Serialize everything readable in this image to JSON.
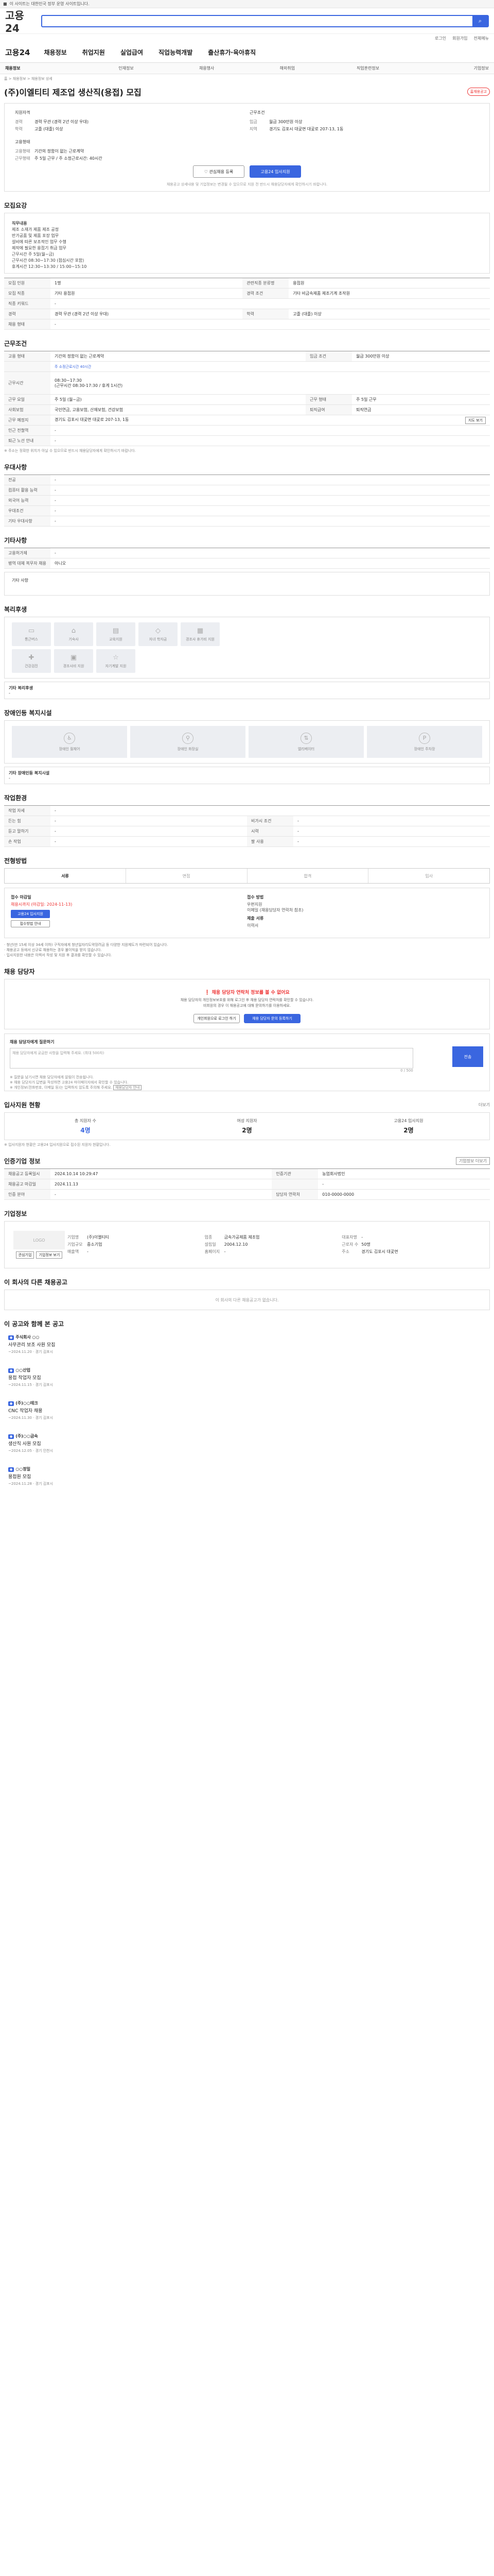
{
  "topbar": {
    "title": "고용24",
    "label": "이 사이트는 대한민국 정부 운영 사이트입니다."
  },
  "header": {
    "logo": "고용24",
    "search_icon": "search-icon"
  },
  "util": {
    "links": [
      "로그인",
      "회원가입",
      "전체메뉴"
    ]
  },
  "gnb": {
    "home": "고용24",
    "items": [
      "채용정보",
      "취업지원",
      "실업급여",
      "직업능력개발",
      "출산휴가·육아휴직"
    ]
  },
  "lnb": {
    "items": [
      "채용정보",
      "인재정보",
      "채용행사",
      "해외취업",
      "직업훈련정보",
      "기업정보"
    ]
  },
  "breadcrumb": "홈 > 채용정보 > 채용정보 상세",
  "job": {
    "badge": "홈채용공고",
    "title": "(주)이엘티티 제조업 생산직(용접) 모집",
    "summary": {
      "left_title": "지원자격",
      "career_k": "경력",
      "career_v": "경력 무관 (경력 2년 이상 우대)",
      "edu_k": "학력",
      "edu_v": "고졸 (대졸) 이상",
      "cond_title": "고용형태",
      "emp_k": "고용형태",
      "emp_v": "기간의 정함이 없는 근로계약",
      "hour_k": "근무형태",
      "hour_v": "주 5일 근무 / 주 소정근로시간: 40시간",
      "right_title": "근무조건",
      "wage_k": "임금",
      "wage_v": "월급 300만원 이상",
      "loc_k": "지역",
      "loc_v": "경기도 김포시 대곶면 대곶로 207-13, 1동"
    },
    "btn_interest": "관심채용 등록",
    "btn_apply": "고용24 입사지원",
    "notice": "채용공고 상세내용 및 기업정보는 변경될 수 있으므로 지원 전 반드시 채용담당자에게 확인하시기 바랍니다."
  },
  "recruit_section": {
    "title": "모집요강",
    "content_title": "직무내용",
    "content": "제조 소재가 제품 제조 공정\n반가공품 및 제품 포장 업무\n설비에 따른 보조적인 업무 수행\n제작에 필요한 용접기 취급 업무\n근무시간 주 5일(월~금)\n근무시간 08:30~17:30 (점심시간 포함)\n휴게시간 12:30~13:30 / 15:00~15:10",
    "rows": [
      [
        "모집 인원",
        "1명",
        "관련직종 분류명",
        "용접원"
      ],
      [
        "모집 직종",
        "기타 용접원",
        "경력 조건",
        "기타 비금속제품 제조기계 조작원"
      ],
      [
        "직종 키워드",
        "-",
        "",
        ""
      ],
      [
        "경력",
        "경력 무관 (경력 2년 이상 우대)",
        "학력",
        "고졸 (대졸) 이상"
      ],
      [
        "채용 형태",
        "-",
        "",
        ""
      ]
    ]
  },
  "work_section": {
    "title": "근무조건",
    "rows": [
      [
        "고용 형태",
        "기간의 정함이 없는 근로계약",
        "임금 조건",
        "월급 300만원 이상"
      ],
      [
        "",
        "주 소정근로시간 40시간",
        "",
        ""
      ],
      [
        "근무시간",
        "08:30~17:30\n(근무시간 08:30-17:30 / 휴게 1시간)",
        "",
        ""
      ],
      [
        "근무 요일",
        "주 5일 (월~금)",
        "근무 형태",
        "주 5일 근무"
      ],
      [
        "사회보험",
        "국민연금, 고용보험, 산재보험, 건강보험",
        "퇴직급여",
        "퇴직연금"
      ],
      [
        "근무 예정지",
        "경기도 김포시 대곶면 대곶로 207-13, 1동",
        "",
        ""
      ],
      [
        "인근 전철역",
        "-",
        "",
        ""
      ],
      [
        "퇴근 노선 안내",
        "-",
        "",
        ""
      ]
    ],
    "map_button": "지도 보기",
    "notice": "※ 주소는 정확한 위치가 아닐 수 있으므로 반드시 채용담당자에게 확인하시기 바랍니다."
  },
  "benefit_section": {
    "title": "우대사항",
    "rows": [
      [
        "전공",
        "-"
      ],
      [
        "컴퓨터 활용 능력",
        "-"
      ],
      [
        "외국어 능력",
        "-"
      ],
      [
        "우대조건",
        "-"
      ],
      [
        "기타 우대사항",
        "-"
      ]
    ]
  },
  "etc_section": {
    "title": "기타사항",
    "rows": [
      [
        "고용허가제",
        "-"
      ],
      [
        "병역 대체 복무자 채용",
        "아니오"
      ]
    ],
    "free_label": "기타 사항"
  },
  "welfare_section": {
    "title": "복리후생",
    "items": [
      "통근버스",
      "기숙사",
      "교육지원",
      "자녀 학자금",
      "경조사 휴가비 지원",
      "건강검진",
      "경조사비 지원",
      "자기계발 지원"
    ],
    "etc_label": "기타 복리후생",
    "etc_value": "-"
  },
  "disability_section": {
    "title": "장애인등 복지시설",
    "items": [
      "장애인 휠체어",
      "장애인 화장실",
      "엘리베이터",
      "장애인 주차장"
    ],
    "etc_label": "기타 장애인등 복지시설",
    "etc_value": "-"
  },
  "task_section": {
    "title": "작업환경",
    "rows": [
      [
        "작업 자세",
        "-",
        ""
      ],
      [
        "든는 힘",
        "-",
        "비가시 조건",
        "-"
      ],
      [
        "듣고 말하기",
        "-",
        "시력",
        "-"
      ],
      [
        "손 작업",
        "-",
        "팔 사용",
        "-"
      ]
    ]
  },
  "process_section": {
    "title": "전형방법",
    "tabs": [
      "서류",
      "면접",
      "합격",
      "입사"
    ],
    "apply": {
      "method_label": "접수 마감일",
      "method_value": "채용시까지 (마감일: 2024-11-13)",
      "apply_btn": "고용24 입사지원",
      "online_btn": "접수방법 안내",
      "doc_label": "접수 방법",
      "doc_value": "우편지원\n이메일 (채용담당자 연락처 참조)",
      "prep_label": "제출 서류",
      "prep_value": "이력서"
    },
    "bullets": [
      "· 청년(만 15세 이상 34세 이하) 구직자에게 청년일자리도약장려금 등 다양한 지원제도가 마련되어 있습니다.",
      "· 채용공고 등에서 신규로 채용하는 경우 불이익을 받지 않습니다.",
      "· 입사지원한 내용은 이력서 작성 및 지원 후 결과를 확인할 수 있습니다."
    ]
  },
  "contact_section": {
    "title": "채용 담당자",
    "alert_title": "채용 담당자 연락처 정보를 볼 수 없어요",
    "alert_text": "채용 담당자의 개인정보보호를 위해 로그인 후 채용 담당자 연락처를 확인할 수 있습니다.\n비회원의 경우 이 채용공고에 대해 문의하기를 이용하세요.",
    "btn_login": "개인회원으로 로그인 하기",
    "btn_inquiry": "채용 담당자 문의 등록하기",
    "inquiry_label": "채용 담당자에게 질문하기",
    "inquiry_ph": "채용 담당자에게 궁금한 사항을 입력해 주세요. (최대 500자)",
    "inquiry_count": "0 / 500",
    "inquiry_send": "전송",
    "inquiry_notes": [
      "※ 질문을 남기시면 채용 담당자에게 알림이 전송됩니다.",
      "※ 채용 담당자가 답변을 작성하면 고용24 마이페이지에서 확인할 수 있습니다.",
      "※ 개인정보(전화번호, 이메일 등)는 입력하지 않도록 주의해 주세요."
    ],
    "help_btn": "채용담당자 안내"
  },
  "stat_section": {
    "title": "입사지원 현황",
    "more": "더보기",
    "stats": [
      [
        "총 지원자 수",
        "4명"
      ],
      [
        "여성 지원자",
        "2명"
      ],
      [
        "고용24 입사지원",
        "2명"
      ]
    ],
    "note": "※ 입사지원자 현황은 고용24 입사지원으로 접수된 지원자 현황입니다."
  },
  "info_section": {
    "title": "인증기업 정보",
    "more_btn": "기업정보 더보기",
    "rows": [
      [
        "채용공고 등록일시",
        "2024.10.14 10:29:47",
        "인증기관",
        "농업회사법인"
      ],
      [
        "채용공고 마감일",
        "2024.11.13",
        "",
        "-"
      ],
      [
        "인증 분야",
        "-",
        "담당자 연락처",
        "010-0000-0000"
      ]
    ]
  },
  "company_section": {
    "title": "기업정보",
    "logo_text": "LOGO",
    "btn1": "관심기업",
    "btn2": "기업정보 보기",
    "rows": [
      [
        "기업명",
        "(주)이엘티티"
      ],
      [
        "업종",
        "금속가공제품 제조업"
      ],
      [
        "대표자명",
        "-"
      ],
      [
        "기업규모",
        "중소기업"
      ],
      [
        "설립일",
        "2004.12.10"
      ],
      [
        "근로자 수",
        "50명"
      ],
      [
        "매출액",
        "-"
      ],
      [
        "홈페이지",
        "-"
      ],
      [
        "주소",
        "경기도 김포시 대곶면"
      ]
    ]
  },
  "similar_section": {
    "title": "이 회사의 다른 채용공고",
    "empty": "이 회사의 다른 채용공고가 없습니다."
  },
  "rec_section": {
    "title": "이 공고와 함께 본 공고",
    "items": [
      {
        "tag": "",
        "co": "주식회사 ○○",
        "title": "사무관리 보조 사원 모집",
        "meta": "~2024.11.20 · 경기 김포시"
      },
      {
        "tag": "",
        "co": "○○산업",
        "title": "용접 작업자 모집",
        "meta": "~2024.11.15 · 경기 김포시"
      },
      {
        "tag": "",
        "co": "(주)○○테크",
        "title": "CNC 작업자 채용",
        "meta": "~2024.11.30 · 경기 김포시"
      },
      {
        "tag": "",
        "co": "(주)○○금속",
        "title": "생산직 사원 모집",
        "meta": "~2024.12.05 · 경기 인천시"
      },
      {
        "tag": "",
        "co": "○○정밀",
        "title": "용접원 모집",
        "meta": "~2024.11.28 · 경기 김포시"
      }
    ]
  }
}
